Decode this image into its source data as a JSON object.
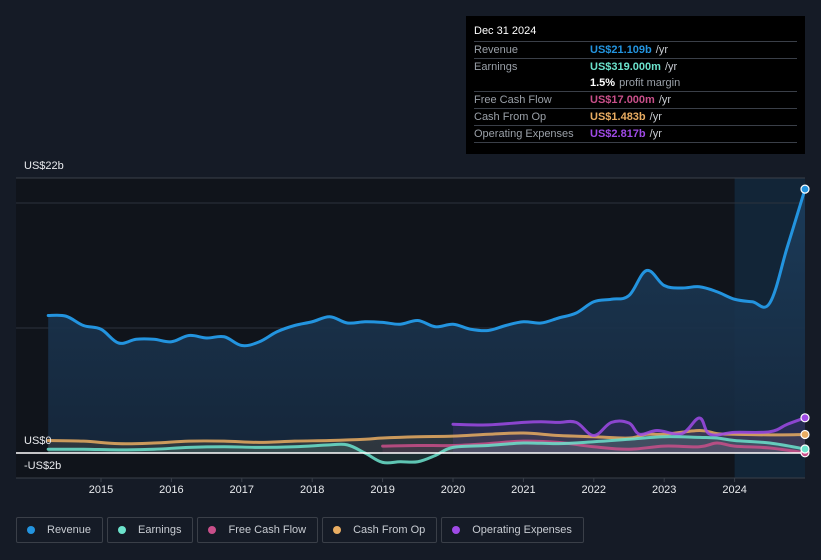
{
  "tooltip": {
    "date": "Dec 31 2024",
    "rows": [
      {
        "label": "Revenue",
        "value": "US$21.109b",
        "unit": "/yr",
        "color": "#2394df"
      },
      {
        "label": "Earnings",
        "value": "US$319.000m",
        "unit": "/yr",
        "color": "#6ce3cc"
      },
      {
        "label": "",
        "value": "1.5%",
        "unit": "profit margin",
        "color": "#ffffff"
      },
      {
        "label": "Free Cash Flow",
        "value": "US$17.000m",
        "unit": "/yr",
        "color": "#c94f8a"
      },
      {
        "label": "Cash From Op",
        "value": "US$1.483b",
        "unit": "/yr",
        "color": "#e9ad62"
      },
      {
        "label": "Operating Expenses",
        "value": "US$2.817b",
        "unit": "/yr",
        "color": "#9f4ae6"
      }
    ]
  },
  "chart_data": {
    "type": "area",
    "title": "",
    "xlabel": "",
    "ylabel": "",
    "y_tick_labels": [
      "US$22b",
      "US$0",
      "-US$2b"
    ],
    "x_tick_labels": [
      "2015",
      "2016",
      "2017",
      "2018",
      "2019",
      "2020",
      "2021",
      "2022",
      "2023",
      "2024"
    ],
    "x_ticks": [
      2015,
      2016,
      2017,
      2018,
      2019,
      2020,
      2021,
      2022,
      2023,
      2024
    ],
    "xlim": [
      2014.33,
      2025.0
    ],
    "ylim": [
      -2,
      22
    ],
    "gridlines": [
      20,
      10
    ],
    "highlight_range": [
      2024.0,
      2025.0
    ],
    "legend_position": "bottom-left",
    "series": [
      {
        "name": "Revenue",
        "color": "#2394df",
        "points": [
          [
            2014.25,
            11.0
          ],
          [
            2014.5,
            10.95
          ],
          [
            2014.75,
            10.2
          ],
          [
            2015.0,
            9.9
          ],
          [
            2015.25,
            8.8
          ],
          [
            2015.5,
            9.1
          ],
          [
            2015.75,
            9.1
          ],
          [
            2016.0,
            8.9
          ],
          [
            2016.25,
            9.4
          ],
          [
            2016.5,
            9.2
          ],
          [
            2016.75,
            9.3
          ],
          [
            2017.0,
            8.6
          ],
          [
            2017.25,
            8.9
          ],
          [
            2017.5,
            9.7
          ],
          [
            2017.75,
            10.2
          ],
          [
            2018.0,
            10.5
          ],
          [
            2018.25,
            10.9
          ],
          [
            2018.5,
            10.4
          ],
          [
            2018.75,
            10.5
          ],
          [
            2019.0,
            10.45
          ],
          [
            2019.25,
            10.3
          ],
          [
            2019.5,
            10.6
          ],
          [
            2019.75,
            10.1
          ],
          [
            2020.0,
            10.3
          ],
          [
            2020.25,
            9.9
          ],
          [
            2020.5,
            9.8
          ],
          [
            2020.75,
            10.2
          ],
          [
            2021.0,
            10.5
          ],
          [
            2021.25,
            10.4
          ],
          [
            2021.5,
            10.8
          ],
          [
            2021.75,
            11.2
          ],
          [
            2022.0,
            12.1
          ],
          [
            2022.25,
            12.3
          ],
          [
            2022.5,
            12.6
          ],
          [
            2022.75,
            14.6
          ],
          [
            2023.0,
            13.4
          ],
          [
            2023.25,
            13.2
          ],
          [
            2023.5,
            13.3
          ],
          [
            2023.75,
            12.9
          ],
          [
            2024.0,
            12.3
          ],
          [
            2024.25,
            12.1
          ],
          [
            2024.5,
            12.0
          ],
          [
            2024.75,
            16.5
          ],
          [
            2025.0,
            21.109
          ]
        ]
      },
      {
        "name": "Earnings",
        "color": "#6ce3cc",
        "points": [
          [
            2014.25,
            0.3
          ],
          [
            2014.75,
            0.3
          ],
          [
            2015.25,
            0.25
          ],
          [
            2015.75,
            0.3
          ],
          [
            2016.25,
            0.45
          ],
          [
            2016.75,
            0.5
          ],
          [
            2017.25,
            0.45
          ],
          [
            2017.75,
            0.5
          ],
          [
            2018.25,
            0.65
          ],
          [
            2018.5,
            0.65
          ],
          [
            2018.75,
            0.0
          ],
          [
            2019.0,
            -0.75
          ],
          [
            2019.25,
            -0.7
          ],
          [
            2019.5,
            -0.7
          ],
          [
            2019.75,
            -0.2
          ],
          [
            2020.0,
            0.45
          ],
          [
            2020.5,
            0.6
          ],
          [
            2021.0,
            0.8
          ],
          [
            2021.5,
            0.75
          ],
          [
            2022.0,
            0.9
          ],
          [
            2022.5,
            1.1
          ],
          [
            2023.0,
            1.3
          ],
          [
            2023.5,
            1.25
          ],
          [
            2023.75,
            1.2
          ],
          [
            2024.0,
            1.0
          ],
          [
            2024.5,
            0.8
          ],
          [
            2025.0,
            0.319
          ]
        ]
      },
      {
        "name": "Free Cash Flow",
        "color": "#c94f8a",
        "points": [
          [
            2019.0,
            0.55
          ],
          [
            2019.5,
            0.6
          ],
          [
            2020.0,
            0.6
          ],
          [
            2020.5,
            0.75
          ],
          [
            2021.0,
            0.95
          ],
          [
            2021.5,
            0.85
          ],
          [
            2022.0,
            0.5
          ],
          [
            2022.5,
            0.3
          ],
          [
            2023.0,
            0.55
          ],
          [
            2023.5,
            0.5
          ],
          [
            2023.75,
            0.8
          ],
          [
            2024.0,
            0.55
          ],
          [
            2024.5,
            0.4
          ],
          [
            2025.0,
            0.017
          ]
        ]
      },
      {
        "name": "Cash From Op",
        "color": "#e9ad62",
        "points": [
          [
            2014.25,
            1.0
          ],
          [
            2014.75,
            0.95
          ],
          [
            2015.25,
            0.75
          ],
          [
            2015.75,
            0.8
          ],
          [
            2016.25,
            0.95
          ],
          [
            2016.75,
            0.95
          ],
          [
            2017.25,
            0.85
          ],
          [
            2017.75,
            0.95
          ],
          [
            2018.25,
            1.0
          ],
          [
            2018.75,
            1.1
          ],
          [
            2019.0,
            1.2
          ],
          [
            2019.5,
            1.3
          ],
          [
            2020.0,
            1.35
          ],
          [
            2020.5,
            1.5
          ],
          [
            2021.0,
            1.6
          ],
          [
            2021.5,
            1.4
          ],
          [
            2022.0,
            1.3
          ],
          [
            2022.5,
            1.2
          ],
          [
            2022.75,
            1.5
          ],
          [
            2023.0,
            1.5
          ],
          [
            2023.5,
            1.8
          ],
          [
            2023.75,
            1.55
          ],
          [
            2024.0,
            1.5
          ],
          [
            2024.5,
            1.45
          ],
          [
            2025.0,
            1.483
          ]
        ]
      },
      {
        "name": "Operating Expenses",
        "color": "#9f4ae6",
        "points": [
          [
            2020.0,
            2.3
          ],
          [
            2020.5,
            2.25
          ],
          [
            2021.0,
            2.45
          ],
          [
            2021.25,
            2.5
          ],
          [
            2021.5,
            2.45
          ],
          [
            2021.75,
            2.45
          ],
          [
            2022.0,
            1.4
          ],
          [
            2022.25,
            2.45
          ],
          [
            2022.5,
            2.4
          ],
          [
            2022.65,
            1.5
          ],
          [
            2022.9,
            1.8
          ],
          [
            2023.25,
            1.55
          ],
          [
            2023.5,
            2.8
          ],
          [
            2023.65,
            1.5
          ],
          [
            2024.0,
            1.65
          ],
          [
            2024.5,
            1.7
          ],
          [
            2024.75,
            2.3
          ],
          [
            2025.0,
            2.817
          ]
        ]
      }
    ]
  },
  "legend": [
    {
      "label": "Revenue",
      "color": "#2394df"
    },
    {
      "label": "Earnings",
      "color": "#6ce3cc"
    },
    {
      "label": "Free Cash Flow",
      "color": "#c94f8a"
    },
    {
      "label": "Cash From Op",
      "color": "#e9ad62"
    },
    {
      "label": "Operating Expenses",
      "color": "#9f4ae6"
    }
  ]
}
